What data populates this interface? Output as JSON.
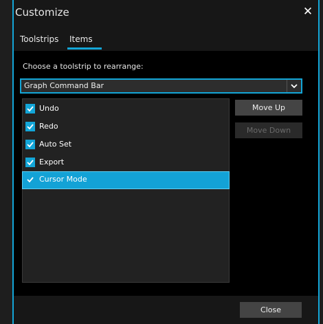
{
  "window": {
    "title": "Customize",
    "accent_color": "#13a6d8"
  },
  "tabs": [
    {
      "label": "Toolstrips",
      "active": false
    },
    {
      "label": "Items",
      "active": true
    }
  ],
  "content": {
    "prompt": "Choose a toolstrip to rearrange:",
    "toolstrip_select": {
      "value": "Graph Command Bar"
    },
    "items": [
      {
        "label": "Undo",
        "checked": true,
        "selected": false
      },
      {
        "label": "Redo",
        "checked": true,
        "selected": false
      },
      {
        "label": "Auto Set",
        "checked": true,
        "selected": false
      },
      {
        "label": "Export",
        "checked": true,
        "selected": false
      },
      {
        "label": "Cursor Mode",
        "checked": true,
        "selected": true
      }
    ],
    "move_up_label": "Move Up",
    "move_down_label": "Move Down"
  },
  "footer": {
    "close_label": "Close"
  }
}
